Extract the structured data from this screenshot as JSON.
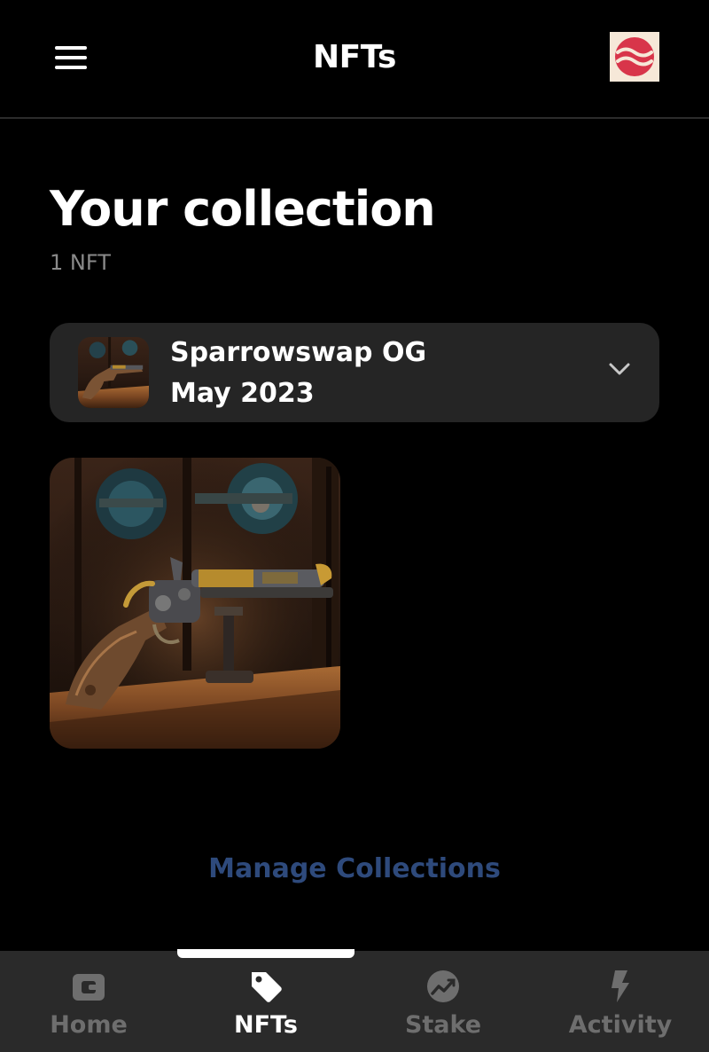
{
  "header": {
    "title": "NFTs",
    "menu_icon": "hamburger-menu-icon",
    "avatar_icon": "sei-logo-icon"
  },
  "collection": {
    "title": "Your collection",
    "count_label": "1 NFT"
  },
  "groups": [
    {
      "name": "Sparrowswap OG",
      "date": "May 2023",
      "thumbnail": "antique-flintlock-pistol-image",
      "expand_icon": "chevron-down-icon"
    }
  ],
  "nfts": [
    {
      "image": "antique-flintlock-pistol-image"
    }
  ],
  "manage_link": "Manage Collections",
  "tabs": [
    {
      "label": "Home",
      "icon": "wallet-icon",
      "active": false
    },
    {
      "label": "NFTs",
      "icon": "tag-icon",
      "active": true
    },
    {
      "label": "Stake",
      "icon": "stake-chart-icon",
      "active": false
    },
    {
      "label": "Activity",
      "icon": "lightning-icon",
      "active": false
    }
  ],
  "colors": {
    "background": "#000000",
    "card": "#252525",
    "tabbar": "#2a2a2a",
    "link": "#2e4a7c",
    "inactive": "#6e6e6e",
    "secondary_text": "#8a8a8a",
    "avatar_bg": "#f6e8d8",
    "avatar_mark": "#d8354a"
  }
}
